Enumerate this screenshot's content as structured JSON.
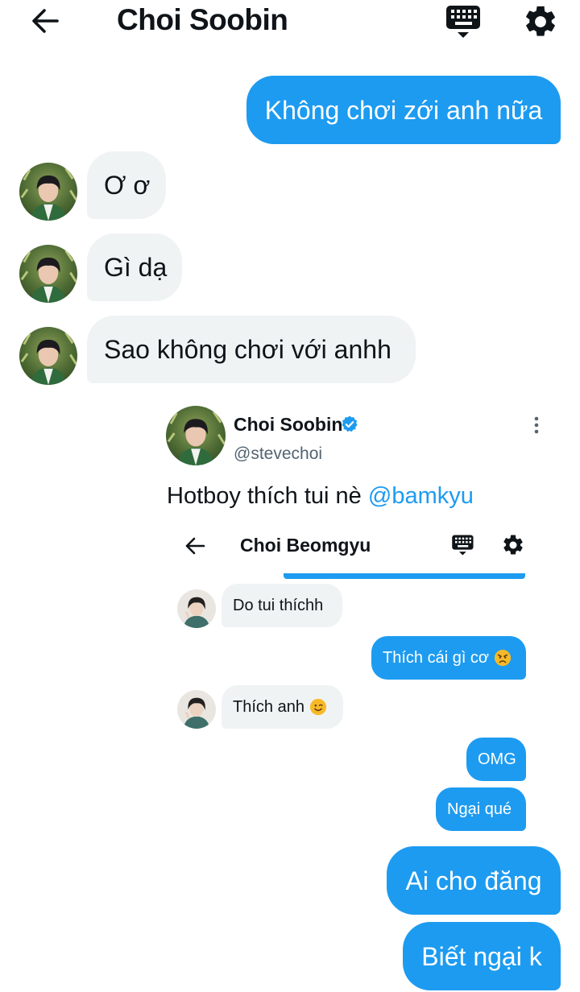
{
  "header": {
    "title": "Choi Soobin",
    "back_icon": "arrow-left-icon",
    "keyboard_icon": "keyboard-icon",
    "settings_icon": "gear-icon"
  },
  "messages": [
    {
      "side": "out",
      "text": "Không chơi zới anh nữa"
    },
    {
      "side": "in",
      "text": "Ơ ơ"
    },
    {
      "side": "in",
      "text": "Gì dạ"
    },
    {
      "side": "in",
      "text": "Sao không chơi với anhh"
    },
    {
      "side": "out",
      "text": "Ai cho đăng"
    },
    {
      "side": "out",
      "text": "Biết ngại k"
    }
  ],
  "tweet": {
    "name": "Choi Soobin",
    "handle": "@stevechoi",
    "text": "Hotboy thích tui nè",
    "mention": "@bamkyu",
    "verified_icon": "verified-badge-icon",
    "more_icon": "more-vertical-icon",
    "screenshot": {
      "title": "Choi Beomgyu",
      "messages": [
        {
          "side": "in",
          "text": "Do tui thíchh"
        },
        {
          "side": "out",
          "text": "Thích cái gì cơ",
          "emoji": "angry-face"
        },
        {
          "side": "in",
          "text": "Thích anh",
          "emoji": "winking-face"
        },
        {
          "side": "out",
          "text": "OMG"
        },
        {
          "side": "out",
          "text": "Ngại qué"
        }
      ]
    }
  },
  "colors": {
    "accent": "#1d9bf0",
    "incoming_bubble": "#eff3f4",
    "text": "#0f1419",
    "secondary_text": "#536471"
  }
}
